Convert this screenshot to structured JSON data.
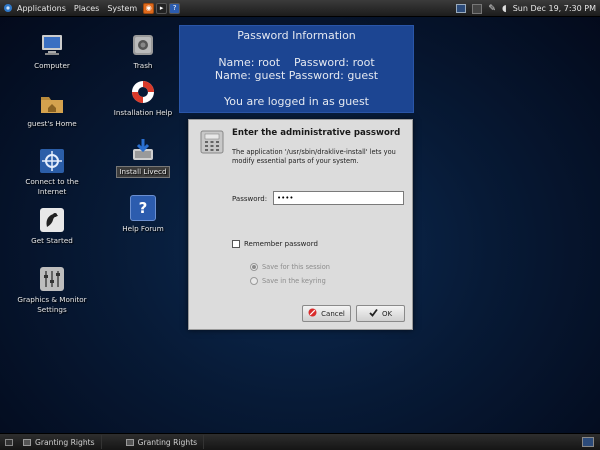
{
  "top_panel": {
    "menus": [
      "Applications",
      "Places",
      "System"
    ],
    "launchers": [
      "firefox-icon",
      "terminal-icon",
      "help-icon"
    ],
    "clock": "Sun Dec 19,  7:30 PM"
  },
  "desktop_icons": [
    {
      "label": "Computer",
      "icon": "computer-icon"
    },
    {
      "label": "guest's Home",
      "icon": "home-folder-icon"
    },
    {
      "label": "Connect to the Internet",
      "icon": "network-icon"
    },
    {
      "label": "Get Started",
      "icon": "get-started-icon"
    },
    {
      "label": "Graphics & Monitor Settings",
      "icon": "settings-sliders-icon"
    },
    {
      "label": "Trash",
      "icon": "trash-icon"
    },
    {
      "label": "Installation Help",
      "icon": "lifebuoy-icon"
    },
    {
      "label": "Install Livecd",
      "icon": "install-icon"
    },
    {
      "label": "Help Forum",
      "icon": "help-forum-icon"
    }
  ],
  "info_box": {
    "title": "Password Information",
    "line1": "Name: root    Password: root",
    "line2": "Name: guest Password: guest",
    "line3": "You are logged in as guest"
  },
  "dialog": {
    "title": "Enter the administrative password",
    "description": "The application '/usr/sbin/draklive-install' lets you modify essential parts of your system.",
    "password_label": "Password:",
    "password_value": "••••",
    "remember_label": "Remember password",
    "remember_checked": false,
    "options": [
      {
        "label": "Save for this session",
        "selected": true
      },
      {
        "label": "Save in the keyring",
        "selected": false
      }
    ],
    "cancel_label": "Cancel",
    "ok_label": "OK"
  },
  "taskbar": {
    "items": [
      "Granting Rights",
      "Granting Rights"
    ]
  }
}
